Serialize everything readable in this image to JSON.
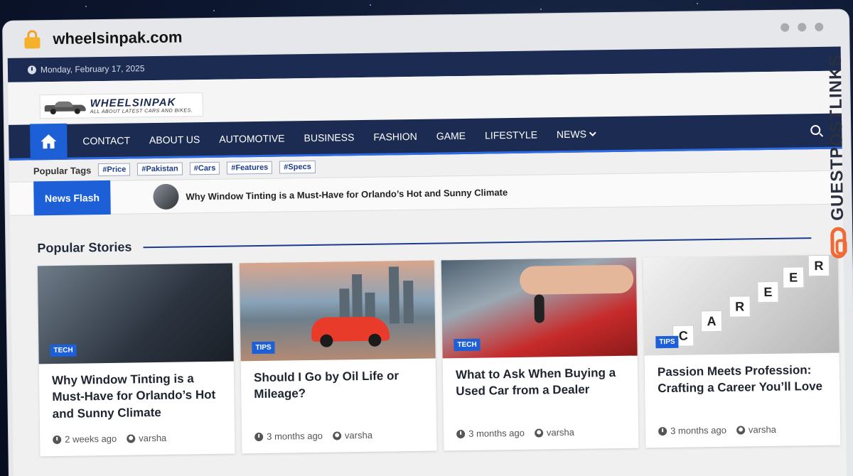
{
  "browser": {
    "url": "wheelsinpak.com"
  },
  "topbar": {
    "date": "Monday, February 17, 2025"
  },
  "logo": {
    "name": "WHEELSINPAK",
    "tagline": "ALL ABOUT LATEST CARS AND BIKES."
  },
  "nav": {
    "items": [
      {
        "label": "CONTACT"
      },
      {
        "label": "ABOUT US"
      },
      {
        "label": "AUTOMOTIVE"
      },
      {
        "label": "BUSINESS"
      },
      {
        "label": "FASHION"
      },
      {
        "label": "GAME"
      },
      {
        "label": "LIFESTYLE"
      },
      {
        "label": "NEWS"
      }
    ]
  },
  "tags": {
    "label": "Popular Tags",
    "items": [
      "#Price",
      "#Pakistan",
      "#Cars",
      "#Features",
      "#Specs"
    ]
  },
  "flash": {
    "label": "News Flash",
    "headline": "Why Window Tinting is a Must-Have for Orlando’s Hot and Sunny Climate"
  },
  "popular": {
    "title": "Popular Stories",
    "cards": [
      {
        "badge": "TECH",
        "title": "Why Window Tinting is a Must-Have for Orlando’s Hot and Sunny Climate",
        "time": "2 weeks ago",
        "author": "varsha"
      },
      {
        "badge": "TIPS",
        "title": "Should I Go by Oil Life or Mileage?",
        "time": "3 months ago",
        "author": "varsha"
      },
      {
        "badge": "TECH",
        "title": "What to Ask When Buying a Used Car from a Dealer",
        "time": "3 months ago",
        "author": "varsha"
      },
      {
        "badge": "TIPS",
        "title": "Passion Meets Profession: Crafting a Career You’ll Love",
        "time": "3 months ago",
        "author": "varsha"
      }
    ]
  },
  "career_letters": [
    "C",
    "A",
    "R",
    "E",
    "E",
    "R"
  ],
  "watermark": {
    "text": "GUESTPOSTLINKS"
  },
  "colors": {
    "navy": "#1c2b52",
    "accent": "#1d5fd6",
    "watermark": "#ef6a36"
  }
}
